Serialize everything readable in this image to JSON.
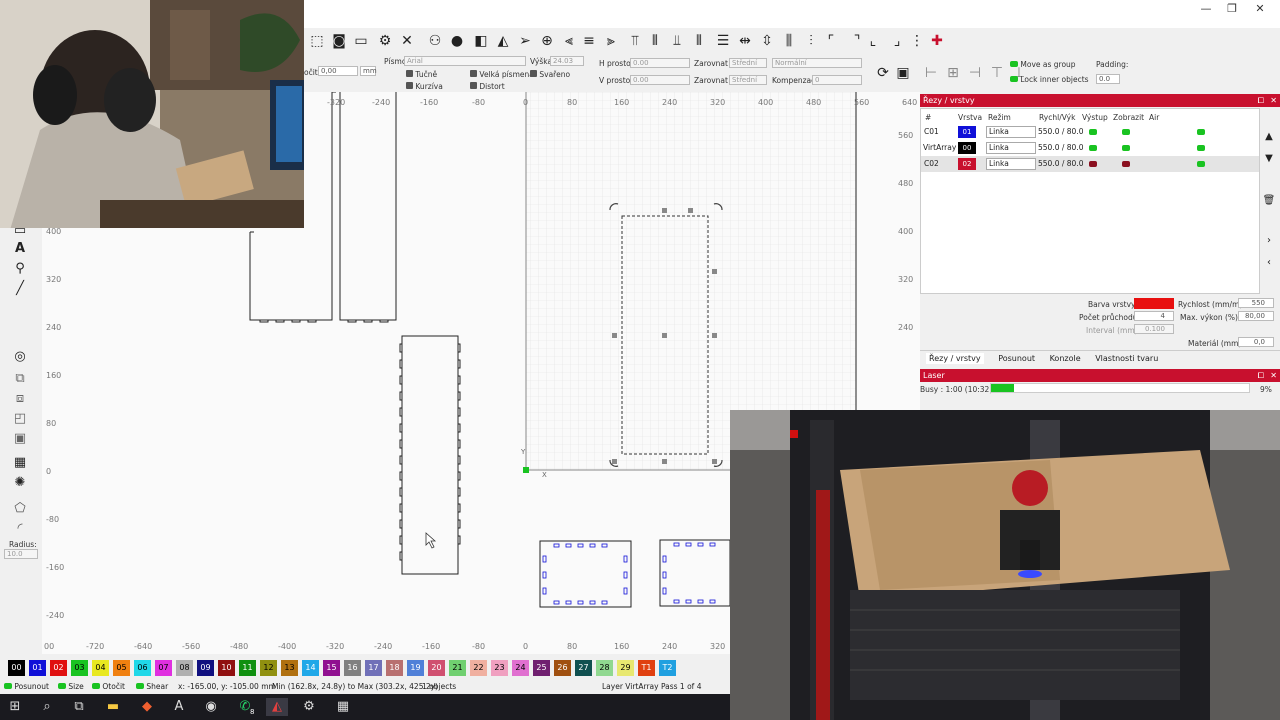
{
  "window": {
    "minimize": "—",
    "maximize": "❐",
    "close": "✕"
  },
  "toolbar": {
    "rotate_label": "očit",
    "rotate_value": "0,00",
    "rotate_unit": "mm",
    "font_label": "Písmo",
    "font_value": "Arial",
    "height_label": "Výška",
    "height_value": "24.03",
    "hspace_label": "H prostor",
    "hspace_value": "0.00",
    "vspace_label": "V prostor",
    "vspace_value": "0.00",
    "alignx_label": "Zarovnat X",
    "alignx_value": "Střední",
    "aligny_label": "Zarovnat Y",
    "aligny_value": "Střední",
    "normal_value": "Normální",
    "comp_label": "Kompenzace",
    "comp_value": "0",
    "bold_label": "Tučně",
    "upper_label": "Velká písmena",
    "welded_label": "Svařeno",
    "italic_label": "Kurzíva",
    "distort_label": "Distort",
    "move_group_label": "Move as group",
    "lock_inner_label": "Lock inner objects",
    "padding_label": "Padding:",
    "padding_value": "0.0"
  },
  "left_tools": {
    "radius_label": "Radius:",
    "radius_value": "10.0"
  },
  "rulers": {
    "top": [
      "-320",
      "-240",
      "-160",
      "-80",
      "0",
      "80",
      "160",
      "240",
      "320",
      "400",
      "480",
      "560",
      "640"
    ],
    "bottom": [
      "00",
      "-720",
      "-640",
      "-560",
      "-480",
      "-400",
      "-320",
      "-240",
      "-160",
      "-80",
      "0",
      "80",
      "160",
      "240",
      "320"
    ],
    "left": [
      "400",
      "320",
      "240",
      "160",
      "80",
      "0",
      "-80",
      "-160",
      "-240"
    ],
    "right": [
      "560",
      "480",
      "400",
      "320",
      "240"
    ],
    "axis_y": "Y",
    "axis_x": "X"
  },
  "layers_panel": {
    "title": "Řezy / vrstvy",
    "headers": [
      "#",
      "Vrstva",
      "Režim",
      "Rychl/Výk",
      "Výstup",
      "Zobrazit",
      "Air"
    ],
    "rows": [
      {
        "id": "C01",
        "layer": "01",
        "color": "#1010d8",
        "mode": "Linka",
        "speed_power": "550.0 / 80.0",
        "output": "on",
        "show": "on",
        "air": "on"
      },
      {
        "id": "VirtArray",
        "layer": "00",
        "color": "#000000",
        "mode": "Linka",
        "speed_power": "550.0 / 80.0",
        "output": "on",
        "show": "on",
        "air": "on"
      },
      {
        "id": "C02",
        "layer": "02",
        "color": "#c8102e",
        "mode": "Linka",
        "speed_power": "550.0 / 80.0",
        "output": "off",
        "show": "off",
        "air": "on"
      }
    ],
    "layer_color_label": "Barva vrstvy",
    "speed_label": "Rychlost (mm/m)",
    "speed_value": "550",
    "passes_label": "Počet průchodů",
    "passes_value": "4",
    "max_power_label": "Max. výkon (%)",
    "max_power_value": "80,00",
    "interval_label": "Interval (mm)",
    "interval_value": "0.100",
    "material_label": "Materiál (mm)",
    "material_value": "0,0",
    "tabs": [
      "Řezy / vrstvy",
      "Posunout",
      "Konzole",
      "Vlastnosti tvaru"
    ]
  },
  "laser_panel": {
    "title": "Laser",
    "status": "Busy : 1:00 (10:32)",
    "progress": 0.09,
    "progress_text": "9%"
  },
  "palette": [
    {
      "label": "00",
      "color": "#000000",
      "text": "#ffffff"
    },
    {
      "label": "01",
      "color": "#1010d8",
      "text": "#ffffff"
    },
    {
      "label": "02",
      "color": "#e01010",
      "text": "#ffffff"
    },
    {
      "label": "03",
      "color": "#19c321",
      "text": "#000000"
    },
    {
      "label": "04",
      "color": "#e8e820",
      "text": "#000000"
    },
    {
      "label": "05",
      "color": "#f08010",
      "text": "#000000"
    },
    {
      "label": "06",
      "color": "#20d8e8",
      "text": "#000000"
    },
    {
      "label": "07",
      "color": "#e030e0",
      "text": "#000000"
    },
    {
      "label": "08",
      "color": "#b0b0b0",
      "text": "#000000"
    },
    {
      "label": "09",
      "color": "#101080",
      "text": "#ffffff"
    },
    {
      "label": "10",
      "color": "#901010",
      "text": "#ffffff"
    },
    {
      "label": "11",
      "color": "#109010",
      "text": "#ffffff"
    },
    {
      "label": "12",
      "color": "#909010",
      "text": "#000000"
    },
    {
      "label": "13",
      "color": "#b07010",
      "text": "#000000"
    },
    {
      "label": "14",
      "color": "#20a8e8",
      "text": "#ffffff"
    },
    {
      "label": "15",
      "color": "#901090",
      "text": "#ffffff"
    },
    {
      "label": "16",
      "color": "#808080",
      "text": "#ffffff"
    },
    {
      "label": "17",
      "color": "#7070b8",
      "text": "#ffffff"
    },
    {
      "label": "18",
      "color": "#b87070",
      "text": "#ffffff"
    },
    {
      "label": "19",
      "color": "#5080d8",
      "text": "#ffffff"
    },
    {
      "label": "20",
      "color": "#d05070",
      "text": "#ffffff"
    },
    {
      "label": "21",
      "color": "#70d070",
      "text": "#000000"
    },
    {
      "label": "22",
      "color": "#f0b0a0",
      "text": "#000000"
    },
    {
      "label": "23",
      "color": "#f0a0c0",
      "text": "#000000"
    },
    {
      "label": "24",
      "color": "#e070d0",
      "text": "#000000"
    },
    {
      "label": "25",
      "color": "#702070",
      "text": "#ffffff"
    },
    {
      "label": "26",
      "color": "#a05010",
      "text": "#ffffff"
    },
    {
      "label": "27",
      "color": "#105050",
      "text": "#ffffff"
    },
    {
      "label": "28",
      "color": "#90d890",
      "text": "#000000"
    },
    {
      "label": "29",
      "color": "#e8e870",
      "text": "#000000"
    },
    {
      "label": "T1",
      "color": "#e04010",
      "text": "#ffffff"
    },
    {
      "label": "T2",
      "color": "#20a0e0",
      "text": "#ffffff"
    }
  ],
  "status": {
    "move_label": "Posunout",
    "size_label": "Size",
    "rotate_label": "Otočit",
    "shear_label": "Shear",
    "coords": "x: -165.00, y: -105.00 mm",
    "bounds": "Min (162.8x, 24.8y) to Max (303.2x, 425.2y)",
    "objects": "1 objects",
    "layer_info": "Layer VirtArray Pass 1 of 4"
  },
  "taskbar": {
    "badge": "8"
  }
}
